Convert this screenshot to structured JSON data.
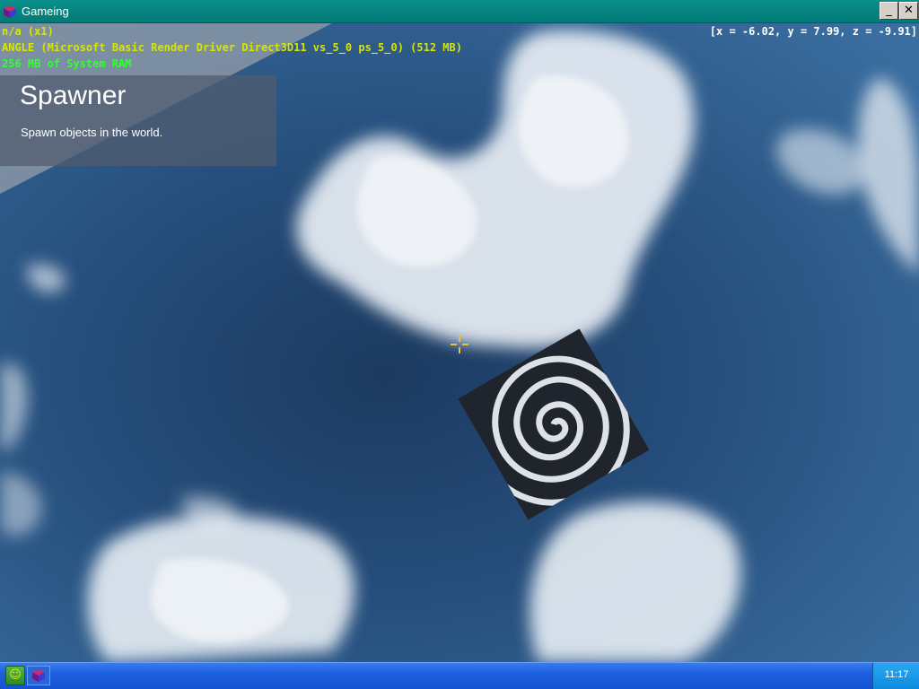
{
  "window": {
    "title": "Gameing",
    "minimize_symbol": "_",
    "close_symbol": "✕",
    "icon": "app-cube-icon"
  },
  "hud": {
    "line1": "n/a (x1)",
    "line2": "ANGLE (Microsoft Basic Render Driver Direct3D11 vs_5_0 ps_5_0) (512 MB)",
    "line3": "256 MB of System RAM",
    "coords": "[x = -6.02, y = 7.99, z = -9.91]"
  },
  "tool": {
    "title": "Spawner",
    "description": "Spawn objects in the world."
  },
  "scene": {
    "object": "spiral-texture-cube",
    "crosshair_color": "#e8c040"
  },
  "taskbar": {
    "start_icon": "start-smiley-icon",
    "task_icon": "app-cube-icon",
    "clock": "11:17"
  },
  "colors": {
    "title_bar": "#0a8f8a",
    "taskbar": "#1c5fe0",
    "hud_yellow": "#d6e600",
    "hud_green": "#33ff33"
  }
}
